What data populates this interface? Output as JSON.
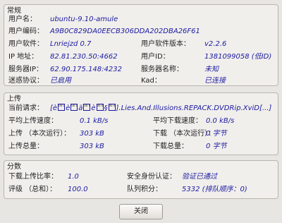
{
  "general": {
    "title": "常规",
    "username_label": "用户名：",
    "username_value": "ubuntu-9.10-amule",
    "user_hash_label": "用户编码：",
    "user_hash_value": "A9B0C829DA0EECB306DDA202DBA26F61",
    "software_label": "用户软件：",
    "software_value": "Lnriejzd 0.7",
    "software_version_label": "用户软件版本：",
    "software_version_value": "v2.2.6",
    "ip_label": "IP 地址：",
    "ip_value": "82.81.230.50:4662",
    "user_id_label": "用户ID：",
    "user_id_value": "1381099058 (低ID)",
    "server_ip_label": "服务器IP：",
    "server_ip_value": "62.90.175.148:4232",
    "server_name_label": "服务器名称：",
    "server_name_value": "未知",
    "obfuscation_label": "迷惑协议：",
    "obfuscation_value": "已启用",
    "kad_label": "Kad：",
    "kad_value": "已连接"
  },
  "upload": {
    "title": "上传",
    "request_label": "当前请求：",
    "request_prefix": "[è",
    "request_mid1": "è",
    "request_mid2": "ä",
    "request_mid3": "è",
    "request_mid4": "§",
    "request_suffix": "].Lies.And.Illusions.REPACK.DVDRip.XviD[...]",
    "glyph_code": "00 00",
    "avg_up_label": "平均上传速度：",
    "avg_up_value": "0.1 kB/s",
    "avg_down_label": "平均下载速度：",
    "avg_down_value": "0.0 kB/s",
    "up_session_label": "上传 （本次运行）：",
    "up_session_value": "303 kB",
    "down_session_label": "下载 （本次运行）：",
    "down_session_value": "0 字节",
    "up_total_label": "上传总量：",
    "up_total_value": "303 kB",
    "down_total_label": "下载总量：",
    "down_total_value": "0 字节"
  },
  "score": {
    "title": "分数",
    "ratio_label": "下载上传比率：",
    "ratio_value": "1.0",
    "secure_id_label": "安全身份认证：",
    "secure_id_value": "验证已通过",
    "rating_label": "评级 （总和）：",
    "rating_value": "100.0",
    "queue_label": "队列积分：",
    "queue_value": "5332 (排队顺序：0)"
  },
  "close_button": "关闭"
}
